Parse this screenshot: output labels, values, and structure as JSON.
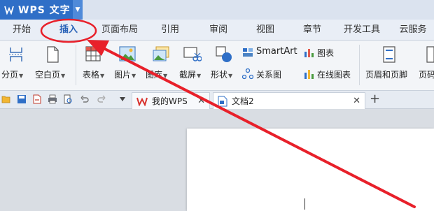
{
  "app": {
    "title": "WPS 文字"
  },
  "tabs": [
    {
      "label": "开始"
    },
    {
      "label": "插入"
    },
    {
      "label": "页面布局"
    },
    {
      "label": "引用"
    },
    {
      "label": "审阅"
    },
    {
      "label": "视图"
    },
    {
      "label": "章节"
    },
    {
      "label": "开发工具"
    },
    {
      "label": "云服务"
    }
  ],
  "ribbon": {
    "page_break": "分页",
    "blank_page": "空白页",
    "table": "表格",
    "picture": "图片",
    "gallery": "图库",
    "screenshot": "截屏",
    "shapes": "形状",
    "smartart": "SmartArt",
    "chart": "图表",
    "relation_chart": "关系图",
    "online_chart": "在线图表",
    "header_footer": "页眉和页脚",
    "page_number": "页码"
  },
  "doc_tabs": [
    {
      "label": "我的WPS"
    },
    {
      "label": "文档2"
    }
  ],
  "new_tab": "+",
  "colors": {
    "accent": "#2f6fc7",
    "annotation": "#e8202a"
  }
}
